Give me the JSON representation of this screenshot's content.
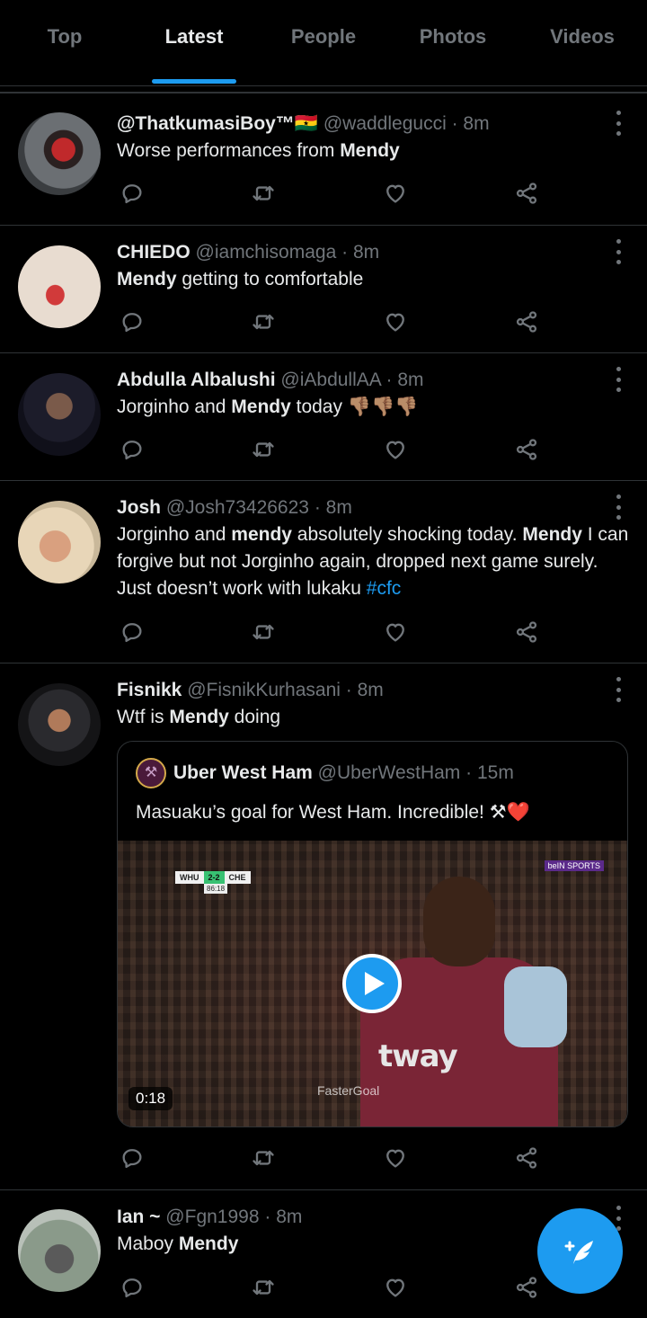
{
  "tabs": [
    {
      "label": "Top",
      "active": false
    },
    {
      "label": "Latest",
      "active": true
    },
    {
      "label": "People",
      "active": false
    },
    {
      "label": "Photos",
      "active": false
    },
    {
      "label": "Videos",
      "active": false
    }
  ],
  "tweets": [
    {
      "name": "@ThatkumasiBoy™🇬🇭",
      "handle": "@waddlegucci",
      "dot": "·",
      "time": "8m",
      "text_parts": [
        "Worse performances from ",
        "Mendy"
      ]
    },
    {
      "name": "CHIEDO",
      "handle": "@iamchisomaga",
      "dot": "·",
      "time": "8m",
      "text_parts": [
        "Mendy",
        " getting to comfortable"
      ]
    },
    {
      "name": "Abdulla Albalushi",
      "handle": "@iAbdullAA",
      "dot": "·",
      "time": "8m",
      "text_parts": [
        "Jorginho and ",
        "Mendy",
        " today ",
        "👎🏽👎🏽👎🏽"
      ]
    },
    {
      "name": "Josh",
      "handle": "@Josh73426623",
      "dot": "·",
      "time": "8m",
      "text_parts": [
        "Jorginho and ",
        "mendy",
        " absolutely shocking today. ",
        "Mendy",
        " I can forgive but not Jorginho again, dropped next game surely. Just doesn’t work with lukaku ",
        "#cfc"
      ]
    },
    {
      "name": "Fisnikk",
      "handle": "@FisnikKurhasani",
      "dot": "·",
      "time": "8m",
      "text_parts": [
        "Wtf is ",
        "Mendy",
        " doing"
      ],
      "quote": {
        "name": "Uber West Ham",
        "handle": "@UberWestHam",
        "dot": "·",
        "time": "15m",
        "text": "Masuaku’s goal for West Ham. Incredible! ⚒❤️",
        "video": {
          "duration": "0:18",
          "score_home": "WHU",
          "score_result": "2-2",
          "score_away": "CHE",
          "clock": "86:18",
          "broadcaster": "beIN SPORTS",
          "sponsor": "tway",
          "watermark": "FasterGoal"
        }
      }
    },
    {
      "name": "Ian ~",
      "handle": "@Fgn1998",
      "dot": "·",
      "time": "8m",
      "text_parts": [
        "Maboy ",
        "Mendy"
      ]
    }
  ],
  "icons": {
    "reply": "reply-icon",
    "retweet": "retweet-icon",
    "like": "like-icon",
    "share": "share-icon",
    "more": "more-icon",
    "compose": "compose-tweet-icon"
  },
  "colors": {
    "background": "#000000",
    "accent": "#1d9bf0",
    "text": "#e7e9ea",
    "muted": "#71767b",
    "border": "#2f3336"
  }
}
